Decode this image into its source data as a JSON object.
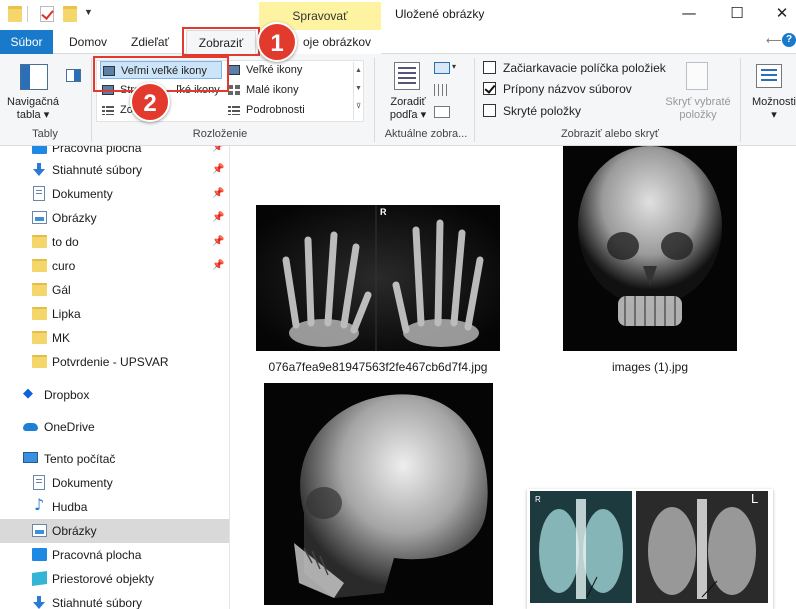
{
  "titlebar": {
    "context_tab": "Spravovať",
    "title": "Uložené obrázky",
    "minimize": "—",
    "maximize": "☐",
    "close": "✕"
  },
  "tabs": {
    "file": "Súbor",
    "home": "Domov",
    "share": "Zdieľať",
    "view": "Zobraziť",
    "manage": "Nástroje obrázkov",
    "manage_visible": "oje obrázkov"
  },
  "ribbon": {
    "panes": {
      "nav_pane": "Navigačná tabla",
      "nav_pane_line1": "Navigačná",
      "nav_pane_line2": "tabla",
      "group_label": "Tably"
    },
    "layout": {
      "group_label": "Rozloženie",
      "items": [
        "Veľmi veľké ikony",
        "Stredne veľké ikony",
        "Zoznam",
        "Veľké ikony",
        "Malé ikony",
        "Podrobnosti"
      ],
      "items_visible_medium": "Stre",
      "items_visible_medium_tail": "ľké ikony",
      "items_visible_list": "Zo",
      "selected": "Veľmi veľké ikony"
    },
    "current_view": {
      "sort_by_line1": "Zoradiť",
      "sort_by_line2": "podľa",
      "group_label": "Aktuálne zobra..."
    },
    "show_hide": {
      "group_label": "Zobraziť alebo skryť",
      "item_checkboxes": "Začiarkavacie políčka položiek",
      "file_extensions": "Prípony názvov súborov",
      "hidden_items": "Skryté položky",
      "hide_selected_line1": "Skryť vybraté",
      "hide_selected_line2": "položky"
    },
    "options": "Možnosti"
  },
  "callouts": {
    "one": "1",
    "two": "2"
  },
  "nav": {
    "quick_access": [
      {
        "label": "Pracovná plocha",
        "icon": "desktop-icon",
        "pinned": true
      },
      {
        "label": "Stiahnuté súbory",
        "icon": "download-icon",
        "pinned": true
      },
      {
        "label": "Dokumenty",
        "icon": "documents-icon",
        "pinned": true
      },
      {
        "label": "Obrázky",
        "icon": "pictures-icon",
        "pinned": true
      },
      {
        "label": "to do",
        "icon": "folder-icon",
        "pinned": true
      },
      {
        "label": "curo",
        "icon": "folder-icon",
        "pinned": true
      },
      {
        "label": "Gál",
        "icon": "folder-icon",
        "pinned": false
      },
      {
        "label": "Lipka",
        "icon": "folder-icon",
        "pinned": false
      },
      {
        "label": "MK",
        "icon": "folder-icon",
        "pinned": false
      },
      {
        "label": "Potvrdenie - UPSVAR",
        "icon": "folder-icon",
        "pinned": false
      }
    ],
    "dropbox": "Dropbox",
    "onedrive": "OneDrive",
    "this_pc": "Tento počítač",
    "pc_items": [
      {
        "label": "Dokumenty",
        "icon": "documents-icon"
      },
      {
        "label": "Hudba",
        "icon": "music-icon"
      },
      {
        "label": "Obrázky",
        "icon": "pictures-icon",
        "selected": true
      },
      {
        "label": "Pracovná plocha",
        "icon": "desktop-icon"
      },
      {
        "label": "Priestorové objekty",
        "icon": "3d-objects-icon"
      },
      {
        "label": "Stiahnuté súbory",
        "icon": "download-icon"
      }
    ]
  },
  "files": [
    {
      "name": "076a7fea9e81947563f2fe467cb6d7f4.jpg",
      "kind": "hands-xray"
    },
    {
      "name": "images (1).jpg",
      "kind": "skull-front-xray"
    },
    {
      "name": "",
      "kind": "skull-side-xray"
    },
    {
      "name": "",
      "kind": "chest-xray"
    }
  ],
  "thumb_text": {
    "r_marker": "R",
    "l_marker": "L"
  }
}
